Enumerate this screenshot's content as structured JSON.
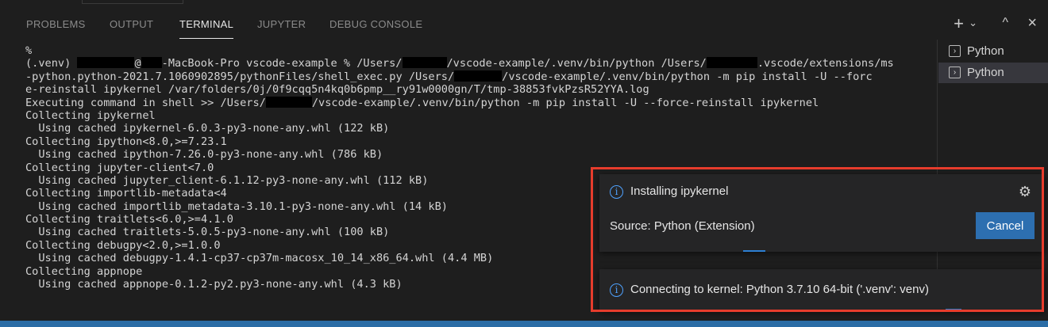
{
  "panel": {
    "tabs": [
      {
        "label": "PROBLEMS",
        "active": false
      },
      {
        "label": "OUTPUT",
        "active": false
      },
      {
        "label": "TERMINAL",
        "active": true
      },
      {
        "label": "JUPYTER",
        "active": false
      },
      {
        "label": "DEBUG CONSOLE",
        "active": false
      }
    ],
    "controls": {
      "add": "+",
      "dropdown": "⌄",
      "maximize": "^",
      "close": "×"
    }
  },
  "terminal_lines": [
    "%",
    "(.venv) [R]@[R]-MacBook-Pro vscode-example % /Users/[R]/vscode-example/.venv/bin/python /Users/[R].vscode/extensions/ms",
    "-python.python-2021.7.1060902895/pythonFiles/shell_exec.py /Users/[R]/vscode-example/.venv/bin/python -m pip install -U --forc",
    "e-reinstall ipykernel /var/folders/0j/0f9cqq5n4kq0b6pmp__ry91w0000gn/T/tmp-38853fvkPzsR52YYA.log",
    "Executing command in shell >> /Users/[R]/vscode-example/.venv/bin/python -m pip install -U --force-reinstall ipykernel",
    "Collecting ipykernel",
    "  Using cached ipykernel-6.0.3-py3-none-any.whl (122 kB)",
    "Collecting ipython<8.0,>=7.23.1",
    "  Using cached ipython-7.26.0-py3-none-any.whl (786 kB)",
    "Collecting jupyter-client<7.0",
    "  Using cached jupyter_client-6.1.12-py3-none-any.whl (112 kB)",
    "Collecting importlib-metadata<4",
    "  Using cached importlib_metadata-3.10.1-py3-none-any.whl (14 kB)",
    "Collecting traitlets<6.0,>=4.1.0",
    "  Using cached traitlets-5.0.5-py3-none-any.whl (100 kB)",
    "Collecting debugpy<2.0,>=1.0.0",
    "  Using cached debugpy-1.4.1-cp37-cp37m-macosx_10_14_x86_64.whl (4.4 MB)",
    "Collecting appnope",
    "  Using cached appnope-0.1.2-py2.py3-none-any.whl (4.3 kB)"
  ],
  "terminal_list": [
    {
      "label": "Python",
      "selected": false
    },
    {
      "label": "Python",
      "selected": true
    }
  ],
  "notifications": {
    "installing": {
      "message": "Installing ipykernel",
      "source": "Source: Python (Extension)",
      "cancel_label": "Cancel"
    },
    "connecting": {
      "message": "Connecting to kernel: Python 3.7.10 64-bit ('.venv': venv)"
    }
  },
  "colors": {
    "accent": "#2d6fb0",
    "highlight_border": "#e63c2c",
    "background": "#1e1e1e"
  }
}
